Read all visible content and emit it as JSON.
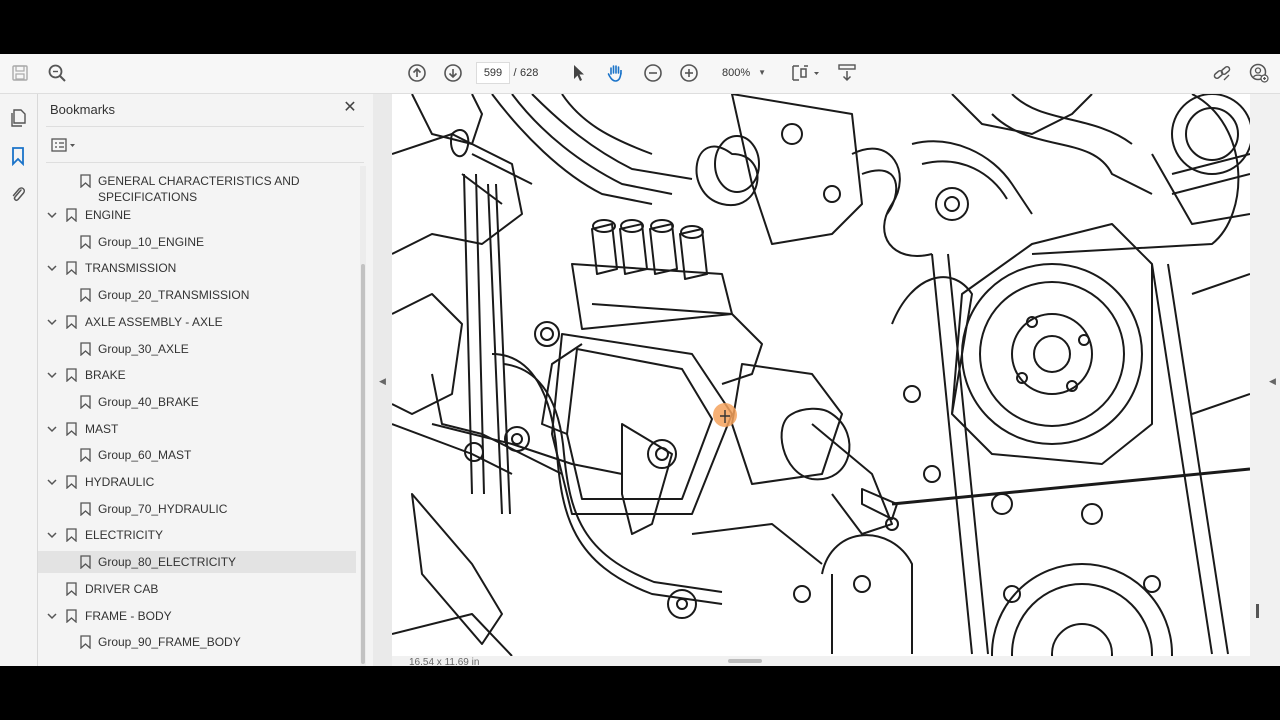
{
  "toolbar": {
    "current_page": "599",
    "page_separator": "/",
    "total_pages": "628",
    "zoom": "800%",
    "icons": [
      "save-icon",
      "search-icon",
      "prev-page-icon",
      "next-page-icon",
      "select-cursor-icon",
      "hand-tool-icon",
      "zoom-out-icon",
      "zoom-in-icon",
      "page-display-icon",
      "scroll-mode-icon",
      "share-link-icon",
      "account-icon"
    ]
  },
  "bookmarks": {
    "title": "Bookmarks",
    "items": [
      {
        "label": "GENERAL CHARACTERISTICS AND",
        "label2": "SPECIFICATIONS",
        "level": 1
      },
      {
        "label": "ENGINE",
        "level": 0,
        "expanded": true
      },
      {
        "label": "Group_10_ENGINE",
        "level": 1
      },
      {
        "label": "TRANSMISSION",
        "level": 0,
        "expanded": true
      },
      {
        "label": "Group_20_TRANSMISSION",
        "level": 1
      },
      {
        "label": "AXLE ASSEMBLY - AXLE",
        "level": 0,
        "expanded": true
      },
      {
        "label": "Group_30_AXLE",
        "level": 1
      },
      {
        "label": "BRAKE",
        "level": 0,
        "expanded": true
      },
      {
        "label": "Group_40_BRAKE",
        "level": 1
      },
      {
        "label": "MAST",
        "level": 0,
        "expanded": true
      },
      {
        "label": "Group_60_MAST",
        "level": 1
      },
      {
        "label": "HYDRAULIC",
        "level": 0,
        "expanded": true
      },
      {
        "label": "Group_70_HYDRAULIC",
        "level": 1
      },
      {
        "label": "ELECTRICITY",
        "level": 0,
        "expanded": true
      },
      {
        "label": "Group_80_ELECTRICITY",
        "level": 1,
        "selected": true
      },
      {
        "label": "DRIVER CAB",
        "level": 0
      },
      {
        "label": "FRAME - BODY",
        "level": 0,
        "expanded": true
      },
      {
        "label": "Group_90_FRAME_BODY",
        "level": 1
      }
    ]
  },
  "status": {
    "page_size": "16.54 x 11.69 in"
  },
  "colors": {
    "cursor_highlight": "#f5a25d",
    "selected_bg": "#e3e3e3"
  }
}
